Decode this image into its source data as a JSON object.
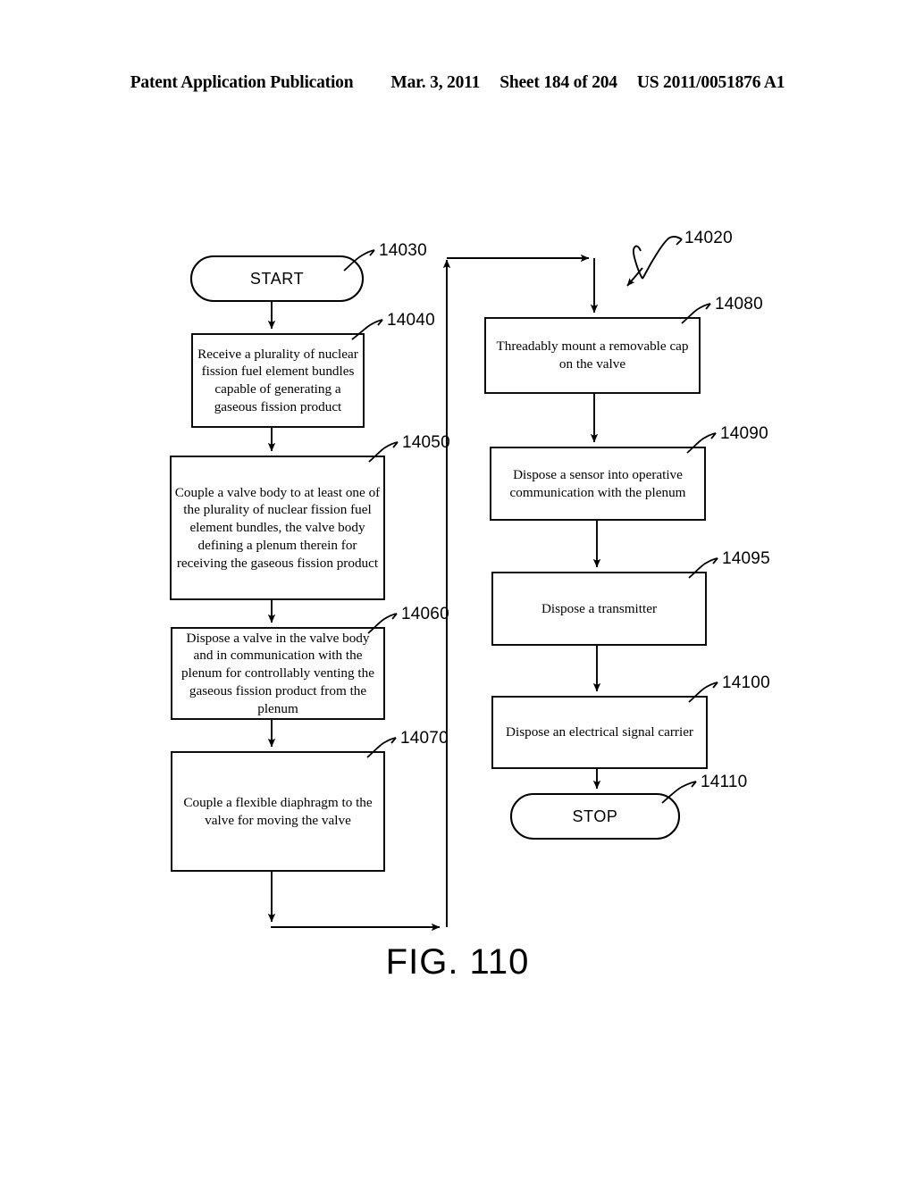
{
  "header": {
    "publication": "Patent Application Publication",
    "date": "Mar. 3, 2011",
    "sheet": "Sheet 184 of 204",
    "patent_number": "US 2011/0051876 A1"
  },
  "caption": "FIG. 110",
  "figure_reference": "14020",
  "nodes": [
    {
      "id": "start",
      "ref": "14030",
      "shape": "terminator",
      "text": "START",
      "column": "left"
    },
    {
      "id": "receive-bundles",
      "ref": "14040",
      "shape": "process",
      "text": "Receive a plurality of nuclear fission fuel element bundles capable of generating a gaseous fission product",
      "column": "left"
    },
    {
      "id": "couple-valve-body",
      "ref": "14050",
      "shape": "process",
      "text": "Couple a valve body to at least one of the plurality of nuclear fission fuel element bundles, the valve body defining a plenum therein for receiving the gaseous fission product",
      "column": "left"
    },
    {
      "id": "dispose-valve",
      "ref": "14060",
      "shape": "process",
      "text": "Dispose a valve in the valve body and in communication with the plenum for controllably venting the gaseous fission product from the plenum",
      "column": "left"
    },
    {
      "id": "couple-diaphragm",
      "ref": "14070",
      "shape": "process",
      "text": "Couple a flexible diaphragm to the valve for moving the valve",
      "column": "left"
    },
    {
      "id": "mount-cap",
      "ref": "14080",
      "shape": "process",
      "text": "Threadably mount a removable cap on the valve",
      "column": "right"
    },
    {
      "id": "dispose-sensor",
      "ref": "14090",
      "shape": "process",
      "text": "Dispose a sensor into operative communication with the plenum",
      "column": "right"
    },
    {
      "id": "dispose-transmitter",
      "ref": "14095",
      "shape": "process",
      "text": "Dispose a transmitter",
      "column": "right"
    },
    {
      "id": "dispose-carrier",
      "ref": "14100",
      "shape": "process",
      "text": "Dispose an electrical signal carrier",
      "column": "right"
    },
    {
      "id": "stop",
      "ref": "14110",
      "shape": "terminator",
      "text": "STOP",
      "column": "right"
    }
  ],
  "colors": {
    "ink": "#000000",
    "paper": "#ffffff"
  }
}
